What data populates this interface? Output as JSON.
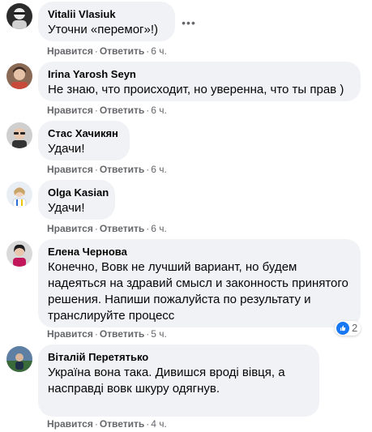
{
  "actions": {
    "like_label": "Нравится",
    "reply_label": "Ответить",
    "separator": "·"
  },
  "comments": [
    {
      "author": "Vitalii Vlasiuk",
      "text": "Уточни «перемог»!)",
      "time": "6 ч."
    },
    {
      "author": "Irina Yarosh Seyn",
      "text": "Не знаю, что происходит, но уверенна, что ты прав )",
      "time": "6 ч."
    },
    {
      "author": "Стас Хачикян",
      "text": "Удачи!",
      "time": "6 ч."
    },
    {
      "author": "Olga Kasian",
      "text": "Удачи!",
      "time": "6 ч."
    },
    {
      "author": "Елена Чернова",
      "text": "Конечно, Вовк не лучший вариант, но будем надеяться на здравий смысл и законность принятого решения. Напиши пожалуйста по результату и транслируйте процесс",
      "time": "5 ч.",
      "reaction_count": "2"
    },
    {
      "author": "Віталій Перетятько",
      "text": "Україна вона така. Дивишся вроді вівця, а насправді вовк шкуру одягнув.",
      "time": "4 ч."
    }
  ],
  "more_label": "•••"
}
